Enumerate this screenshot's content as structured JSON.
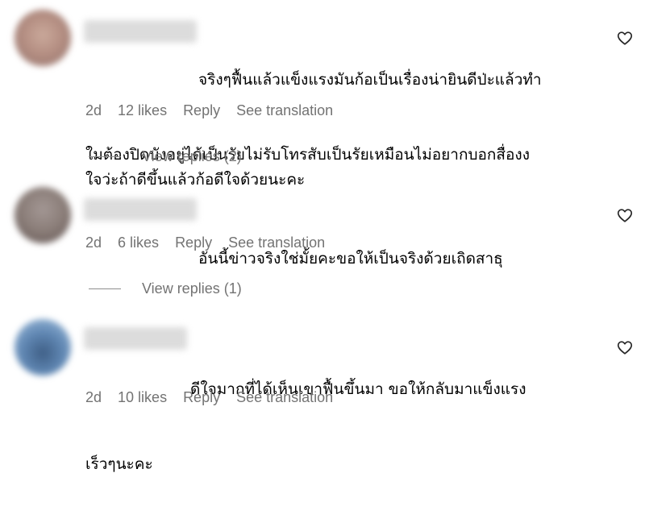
{
  "comments": [
    {
      "text_line1": "จริงๆฟื้นแล้วแข็งแรงมันก้อเป็นเรื่องน่ายินดีป่ะแล้วทำ",
      "text_rest": "ใมต้องปิดบังอยู่ได้เป็นรัยไม่รับโทรสับเป็นรัยเหมือนไม่อยากบอกสื่องง\nใจว่ะถ้าดีขึ้นแล้วก้อดีใจด้วยนะคะ",
      "time": "2d",
      "likes": "12 likes",
      "reply_label": "Reply",
      "translate_label": "See translation",
      "view_replies": "View replies (2)",
      "avatar_color": "#b79a8f"
    },
    {
      "text_line1": "อันนี้ข่าวจริงใช่มั้ยคะขอให้เป็นจริงด้วยเถิดสาธุ",
      "text_rest": "",
      "time": "2d",
      "likes": "6 likes",
      "reply_label": "Reply",
      "translate_label": "See translation",
      "view_replies": "View replies (1)",
      "avatar_color": "#8f8480"
    },
    {
      "text_line1": "ดีใจมากที่ได้เห็นเขาฟื้นขึ้นมา ขอให้กลับมาแข็งแรง",
      "text_rest": "เร็วๆนะคะ",
      "time": "2d",
      "likes": "10 likes",
      "reply_label": "Reply",
      "translate_label": "See translation",
      "view_replies": "",
      "avatar_color": "#6f8fb3"
    }
  ],
  "icons": {
    "like": "heart-outline-icon"
  },
  "colors": {
    "meta_text": "#737373",
    "main_text": "#000000"
  }
}
